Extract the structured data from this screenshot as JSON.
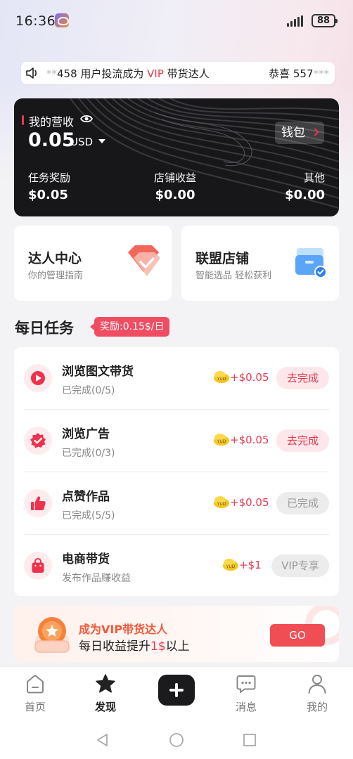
{
  "status_bar": {
    "time": "16:36",
    "battery": "88",
    "app_icon": "app-notification-icon",
    "signal_icon": "signal-icon"
  },
  "marquee": {
    "icon": "speaker-icon",
    "msg1_mask": "**",
    "msg1_text": "458 用户投流成为 ",
    "msg1_vip": "VIP",
    "msg1_tail": " 带货达人",
    "msg2_text": "恭喜 557",
    "msg2_mask": "***"
  },
  "earnings": {
    "title": "我的营收",
    "amount": "0.05",
    "currency": "USD",
    "wallet_label": "钱包",
    "stats": [
      {
        "label": "任务奖励",
        "value": "$0.05"
      },
      {
        "label": "店铺收益",
        "value": "$0.00"
      },
      {
        "label": "其他",
        "value": "$0.00"
      }
    ]
  },
  "features": [
    {
      "title": "达人中心",
      "subtitle": "你的管理指南",
      "icon": "diamond-badge-icon"
    },
    {
      "title": "联盟店铺",
      "subtitle": "智能选品 轻松获利",
      "icon": "store-box-icon"
    }
  ],
  "daily": {
    "title": "每日任务",
    "reward_badge": "奖励:0.15$/日"
  },
  "tasks": [
    {
      "name": "浏览图文带货",
      "progress": "已完成(0/5)",
      "reward": "+$0.05",
      "button": "去完成",
      "state": "todo",
      "icon": "play-icon"
    },
    {
      "name": "浏览广告",
      "progress": "已完成(0/3)",
      "reward": "+$0.05",
      "button": "去完成",
      "state": "todo",
      "icon": "verified-badge-icon"
    },
    {
      "name": "点赞作品",
      "progress": "已完成(5/5)",
      "reward": "+$0.05",
      "button": "已完成",
      "state": "done",
      "icon": "thumbs-up-icon"
    },
    {
      "name": "电商带货",
      "progress": "发布作品赚收益",
      "reward": "+$1",
      "button": "VIP专享",
      "state": "vip",
      "icon": "shopping-bag-icon"
    }
  ],
  "coin_label": "YUD",
  "vip_banner": {
    "line1": "成为VIP带货达人",
    "line2_pre": "每日收益提升",
    "line2_hl": "1$",
    "line2_post": "以上",
    "button": "GO"
  },
  "bottom_nav": [
    {
      "label": "首页",
      "icon": "home-icon"
    },
    {
      "label": "发现",
      "icon": "star-icon",
      "active": true
    },
    {
      "label": "",
      "icon": "plus-icon"
    },
    {
      "label": "消息",
      "icon": "message-icon"
    },
    {
      "label": "我的",
      "icon": "profile-icon"
    }
  ],
  "colors": {
    "accent": "#e8394f",
    "card_dark": "#17171a",
    "page_bg": "#f3f3f5"
  }
}
